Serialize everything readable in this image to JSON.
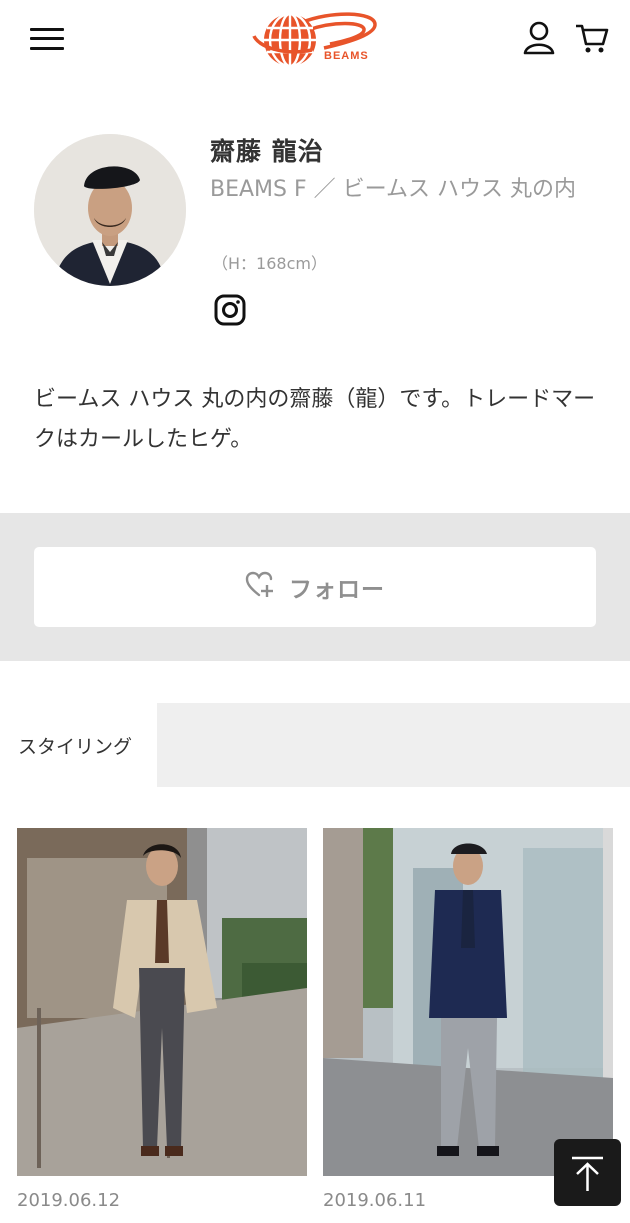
{
  "header": {
    "logo_text": "BEAMS",
    "menu_icon": "hamburger-menu-icon",
    "user_icon": "user-icon",
    "cart_icon": "cart-icon"
  },
  "profile": {
    "name": "齋藤 龍治",
    "shop": "BEAMS F ／ ビームス ハウス 丸の内",
    "height": "（H：168cm）",
    "social_icon": "instagram-icon"
  },
  "bio": "ビームス ハウス 丸の内の齋藤（龍）です。トレードマークはカールしたヒゲ。",
  "follow": {
    "label": "フォロー",
    "icon": "heart-plus-icon"
  },
  "tabs": [
    {
      "label": "スタイリング",
      "active": true
    }
  ],
  "stylings": [
    {
      "date": "2019.06.12"
    },
    {
      "date": "2019.06.11"
    }
  ],
  "back_to_top": {
    "icon": "arrow-up-icon"
  },
  "colors": {
    "brand": "#e8542a",
    "band": "#e6e6e6",
    "muted_text": "#9a9a9a"
  }
}
